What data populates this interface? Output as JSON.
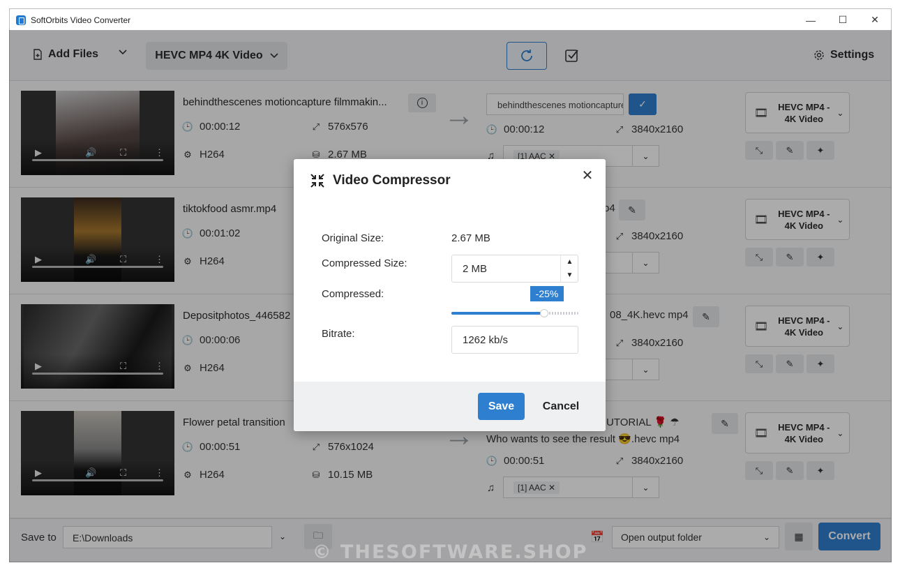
{
  "app": {
    "title": "SoftOrbits Video Converter",
    "minimize": "—",
    "maximize": "☐",
    "close": "✕"
  },
  "toolbar": {
    "add_files": "Add Files",
    "profile": "HEVC MP4 4K Video",
    "settings": "Settings"
  },
  "rows": [
    {
      "name": "behindthescenes motioncapture filmmakin...",
      "duration": "00:00:12",
      "resolution": "576x576",
      "codec": "H264",
      "size": "2.67 MB",
      "out_name": "behindthescenes  motioncapture",
      "out_duration": "00:00:12",
      "out_resolution": "3840x2160",
      "audio": "[1] AAC ✕",
      "format": "HEVC MP4 - 4K Video"
    },
    {
      "name": "tiktokfood asmr.mp4",
      "duration": "00:01:02",
      "codec": "H264",
      "out_name_suffix": "p4",
      "out_resolution": "3840x2160",
      "format": "HEVC MP4 - 4K Video"
    },
    {
      "name": "Depositphotos_446582",
      "duration": "00:00:06",
      "codec": "H264",
      "out_name_suffix": "08_4K.hevc mp4",
      "out_resolution": "3840x2160",
      "format": "HEVC MP4 - 4K Video"
    },
    {
      "name": "Flower petal transition",
      "duration": "00:00:51",
      "resolution": "576x1024",
      "codec": "H264",
      "size": "10.15 MB",
      "out_name_line1": "UTORIAL 🌹 ☂",
      "out_name_line2": "Who wants to see the result 😎.hevc mp4",
      "out_duration": "00:00:51",
      "out_resolution": "3840x2160",
      "audio": "[1] AAC ✕",
      "format": "HEVC MP4 - 4K Video"
    }
  ],
  "bottom": {
    "save_to": "Save to",
    "path": "E:\\Downloads",
    "open_option": "Open output folder",
    "convert": "Convert"
  },
  "dialog": {
    "title": "Video Compressor",
    "original_label": "Original Size:",
    "original_value": "2.67 MB",
    "compressed_size_label": "Compressed Size:",
    "compressed_size_value": "2 MB",
    "compressed_label": "Compressed:",
    "compressed_percent": "-25%",
    "compressed_level": 0.73,
    "bitrate_label": "Bitrate:",
    "bitrate_value": "1262 kb/s",
    "save": "Save",
    "cancel": "Cancel"
  },
  "watermark": "© THESOFTWARE.SHOP",
  "colors": {
    "accent": "#2f7fd0",
    "overlay": "rgba(0,0,0,0.33)"
  }
}
